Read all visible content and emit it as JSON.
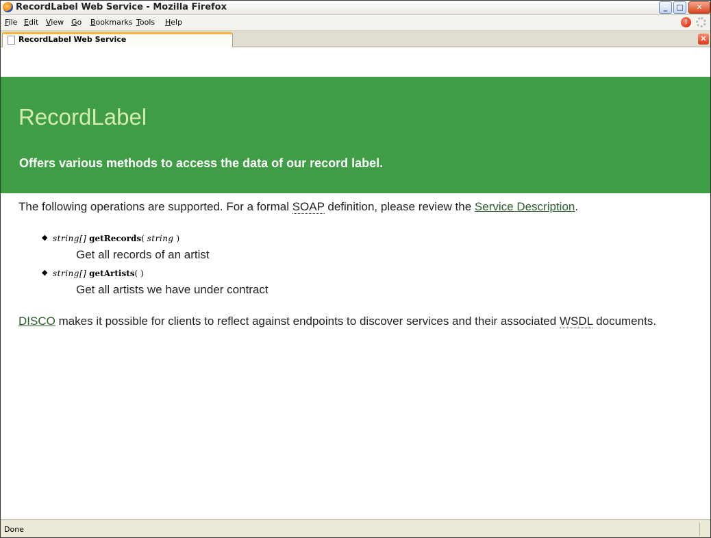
{
  "window": {
    "title": "RecordLabel Web Service - Mozilla Firefox",
    "controls": {
      "minimize": "_",
      "maximize": "□",
      "close": "✕"
    }
  },
  "menu": {
    "items": [
      {
        "ul": "F",
        "rest": "ile"
      },
      {
        "ul": "E",
        "rest": "dit"
      },
      {
        "ul": "V",
        "rest": "iew"
      },
      {
        "ul": "G",
        "rest": "o"
      },
      {
        "ul": "B",
        "rest": "ookmarks"
      },
      {
        "ul": "T",
        "rest": "ools"
      },
      {
        "ul": "H",
        "rest": "elp"
      }
    ],
    "stop_glyph": "!"
  },
  "tabs": {
    "active_label": "RecordLabel Web Service",
    "close_glyph": "✕"
  },
  "page": {
    "header_title": "RecordLabel",
    "header_subtitle": "Offers various methods to access the data of our record label.",
    "intro_prefix": "The following operations are supported. For a formal ",
    "intro_abbr": "SOAP",
    "intro_middle": " definition, please review the ",
    "intro_link": "Service Description",
    "intro_suffix": ".",
    "operations": [
      {
        "return_type": "string[]",
        "name": "getRecords",
        "open": "(",
        "param": "string",
        "close": ")",
        "description": "Get all records of an artist"
      },
      {
        "return_type": "string[]",
        "name": "getArtists",
        "open": "(",
        "param": "",
        "close": ")",
        "description": "Get all artists we have under contract"
      }
    ],
    "bullet": "◆",
    "disco_link": "DISCO",
    "disco_text": " makes it possible for clients to reflect against endpoints to discover services and their associated ",
    "disco_abbr": "WSDL",
    "disco_suffix": " documents."
  },
  "status": {
    "text": "Done"
  }
}
